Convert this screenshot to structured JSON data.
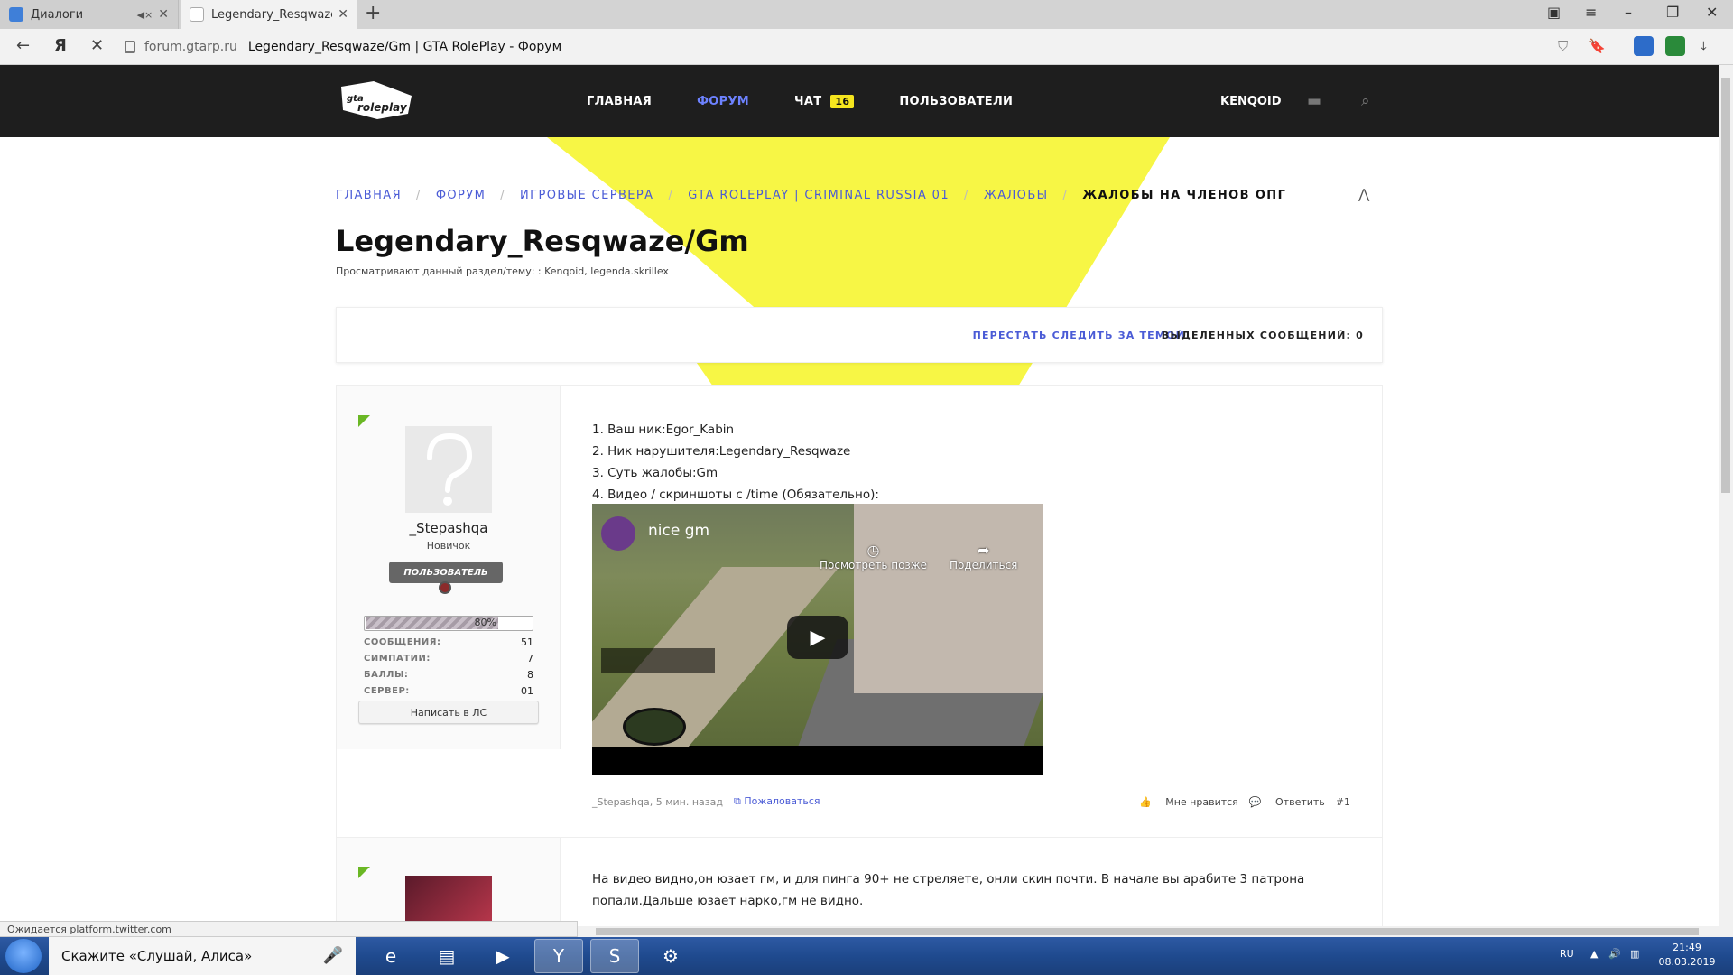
{
  "browser": {
    "tabs": [
      {
        "title": "Диалоги",
        "active": false
      },
      {
        "title": "Legendary_Resqwaze/Gm",
        "active": true
      }
    ],
    "url_host": "forum.gtarp.ru",
    "url_title": "Legendary_Resqwaze/Gm | GTA RolePlay - Форум",
    "status_text": "Ожидается platform.twitter.com"
  },
  "header": {
    "nav": [
      {
        "label": "ГЛАВНАЯ"
      },
      {
        "label": "ФОРУМ"
      },
      {
        "label": "ЧАТ"
      },
      {
        "label": "ПОЛЬЗОВАТЕЛИ"
      }
    ],
    "chat_count": "16",
    "username": "KENQOID"
  },
  "breadcrumbs": [
    "ГЛАВНАЯ",
    "ФОРУМ",
    "ИГРОВЫЕ СЕРВЕРА",
    "GTA ROLEPLAY | CRIMINAL RUSSIA 01",
    "ЖАЛОБЫ"
  ],
  "breadcrumb_current": "ЖАЛОБЫ НА ЧЛЕНОВ ОПГ",
  "page": {
    "title": "Legendary_Resqwaze/Gm",
    "viewers": "Просматривают данный раздел/тему: : Kenqoid, legenda.skrillex"
  },
  "toolbar": {
    "unfollow": "ПЕРЕСТАТЬ СЛЕДИТЬ ЗА ТЕМОЙ",
    "selected": "ВЫДЕЛЕННЫХ СООБЩЕНИЙ: 0"
  },
  "post1": {
    "author": "_Stepashqa",
    "rank": "Новичок",
    "role": "ПОЛЬЗОВАТЕЛЬ",
    "progress_pct": 80,
    "progress_label": "80%",
    "stats": [
      {
        "k": "СООБЩЕНИЯ:",
        "v": "51"
      },
      {
        "k": "СИМПАТИИ:",
        "v": "7"
      },
      {
        "k": "БАЛЛЫ:",
        "v": "8"
      },
      {
        "k": "СЕРВЕР:",
        "v": "01"
      }
    ],
    "pm_button": "Написать в ЛС",
    "lines": [
      "1. Ваш ник:Egor_Kabin",
      "2. Ник нарушителя:Legendary_Resqwaze",
      "3. Суть жалобы:Gm",
      "4. Видео / скриншоты с /time (Обязательно):"
    ],
    "video": {
      "title": "nice gm",
      "watch_later": "Посмотреть позже",
      "share": "Поделиться"
    },
    "meta": "_Stepashqa, 5 мин. назад",
    "report": "Пожаловаться",
    "like": "Мне нравится",
    "reply": "Ответить",
    "number": "#1"
  },
  "post2": {
    "lines": [
      "На видео видно,он юзает гм, и для пинга 90+ не стреляете, онли скин почти. В начале вы арабите 3 патрона",
      "попали.Дальше юзает нарко,гм не видно."
    ]
  },
  "taskbar": {
    "search_text": "Скажите «Слушай, Алиса»",
    "lang": "RU",
    "time": "21:49",
    "date": "08.03.2019"
  }
}
